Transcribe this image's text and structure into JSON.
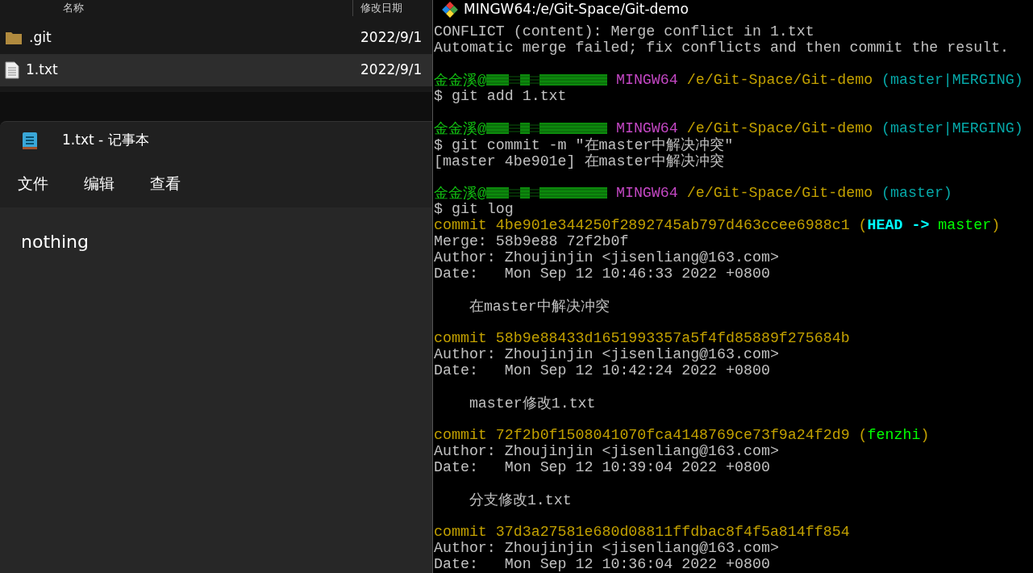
{
  "explorer": {
    "columns": [
      "名称",
      "修改日期"
    ],
    "rows": [
      {
        "kind": "folder",
        "name": ".git",
        "date": "2022/9/1",
        "selected": false
      },
      {
        "kind": "file",
        "name": "1.txt",
        "date": "2022/9/1",
        "selected": true
      }
    ]
  },
  "notepad": {
    "title": "1.txt - 记事本",
    "menu": [
      "文件",
      "编辑",
      "查看"
    ],
    "content": "nothing"
  },
  "terminal": {
    "title": "MINGW64:/e/Git-Space/Git-demo",
    "blocks": [
      [
        [
          {
            "kind": "plain",
            "text": "CONFLICT (content): Merge conflict in 1.txt"
          }
        ],
        [
          {
            "kind": "plain",
            "text": "Automatic merge failed; fix conflicts and then commit the result."
          }
        ]
      ],
      [
        [
          {
            "kind": "user",
            "text": "金金溪@"
          },
          {
            "kind": "redacted"
          },
          {
            "kind": "host",
            "text": "MINGW64"
          },
          {
            "kind": "path",
            "text": "/e/Git-Space/Git-demo"
          },
          {
            "kind": "branch",
            "text": "(master|MERGING)"
          }
        ],
        [
          {
            "kind": "plain",
            "text": "$ git add 1.txt"
          }
        ]
      ],
      [
        [
          {
            "kind": "user",
            "text": "金金溪@"
          },
          {
            "kind": "redacted"
          },
          {
            "kind": "host",
            "text": "MINGW64"
          },
          {
            "kind": "path",
            "text": "/e/Git-Space/Git-demo"
          },
          {
            "kind": "branch",
            "text": "(master|MERGING)"
          }
        ],
        [
          {
            "kind": "plain",
            "text": "$ git commit -m \"在master中解决冲突\""
          }
        ],
        [
          {
            "kind": "plain",
            "text": "[master 4be901e] 在master中解决冲突"
          }
        ]
      ],
      [
        [
          {
            "kind": "user",
            "text": "金金溪@"
          },
          {
            "kind": "redacted"
          },
          {
            "kind": "host",
            "text": "MINGW64"
          },
          {
            "kind": "path",
            "text": "/e/Git-Space/Git-demo"
          },
          {
            "kind": "branch",
            "text": "(master)"
          }
        ],
        [
          {
            "kind": "plain",
            "text": "$ git log"
          }
        ],
        [
          {
            "kind": "hash",
            "text": "commit 4be901e344250f2892745ab797d463ccee6988c1"
          },
          {
            "kind": "hash",
            "text": "("
          },
          {
            "kind": "head",
            "text": "HEAD ->"
          },
          {
            "kind": "ref",
            "text": "master"
          },
          {
            "kind": "hash",
            "text": ")"
          }
        ],
        [
          {
            "kind": "plain",
            "text": "Merge: 58b9e88 72f2b0f"
          }
        ],
        [
          {
            "kind": "plain",
            "text": "Author: Zhoujinjin <jisenliang@163.com>"
          }
        ],
        [
          {
            "kind": "plain",
            "text": "Date:   Mon Sep 12 10:46:33 2022 +0800"
          }
        ]
      ],
      [
        [
          {
            "kind": "message",
            "text": "在master中解决冲突"
          }
        ]
      ],
      [
        [
          {
            "kind": "hash",
            "text": "commit 58b9e88433d1651993357a5f4fd85889f275684b"
          }
        ],
        [
          {
            "kind": "plain",
            "text": "Author: Zhoujinjin <jisenliang@163.com>"
          }
        ],
        [
          {
            "kind": "plain",
            "text": "Date:   Mon Sep 12 10:42:24 2022 +0800"
          }
        ]
      ],
      [
        [
          {
            "kind": "message",
            "text": "master修改1.txt"
          }
        ]
      ],
      [
        [
          {
            "kind": "hash",
            "text": "commit 72f2b0f1508041070fca4148769ce73f9a24f2d9"
          },
          {
            "kind": "hash",
            "text": "("
          },
          {
            "kind": "ref",
            "text": "fenzhi"
          },
          {
            "kind": "hash",
            "text": ")"
          }
        ],
        [
          {
            "kind": "plain",
            "text": "Author: Zhoujinjin <jisenliang@163.com>"
          }
        ],
        [
          {
            "kind": "plain",
            "text": "Date:   Mon Sep 12 10:39:04 2022 +0800"
          }
        ]
      ],
      [
        [
          {
            "kind": "message",
            "text": "分支修改1.txt"
          }
        ]
      ],
      [
        [
          {
            "kind": "hash",
            "text": "commit 37d3a27581e680d08811ffdbac8f4f5a814ff854"
          }
        ],
        [
          {
            "kind": "plain",
            "text": "Author: Zhoujinjin <jisenliang@163.com>"
          }
        ],
        [
          {
            "kind": "plain",
            "text": "Date:   Mon Sep 12 10:36:04 2022 +0800"
          }
        ]
      ]
    ]
  }
}
